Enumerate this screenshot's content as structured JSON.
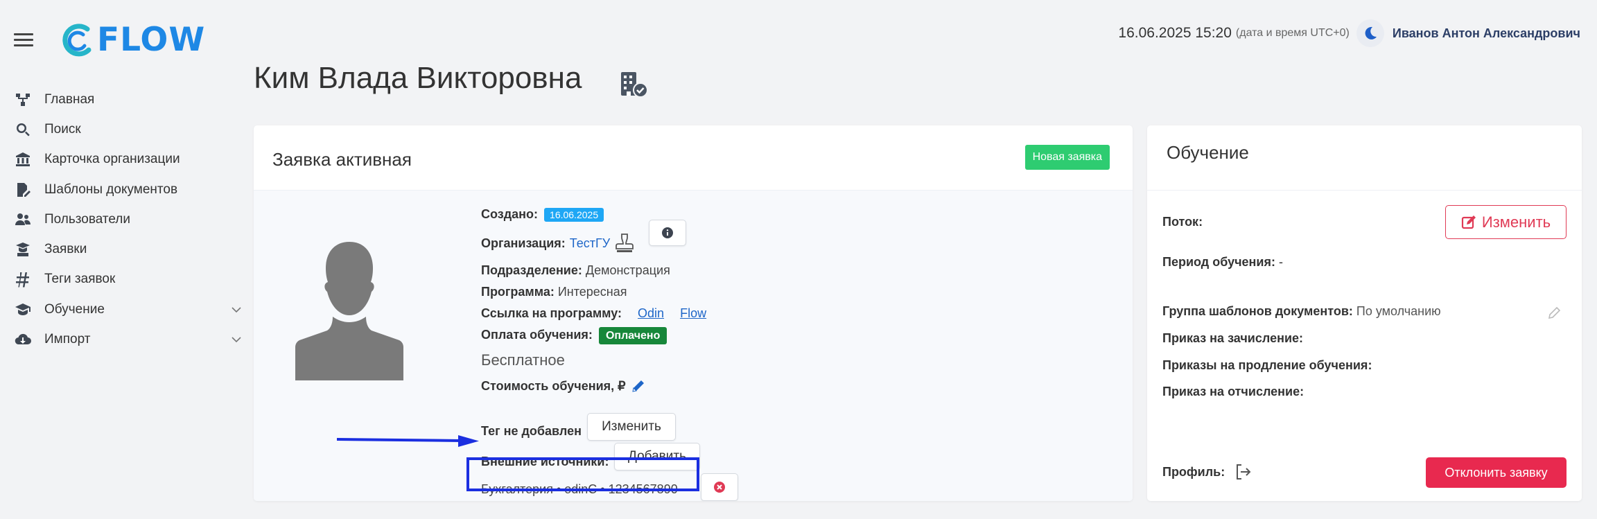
{
  "brand": {
    "name": "FLOW"
  },
  "header": {
    "datetime": "16.06.2025 15:20",
    "timezone_note": "(дата и время UTC+0)",
    "user_name": "Иванов Антон Александрович"
  },
  "sidebar": {
    "items": [
      {
        "label": "Главная",
        "icon": "sitemap-icon"
      },
      {
        "label": "Поиск",
        "icon": "search-icon"
      },
      {
        "label": "Карточка организации",
        "icon": "bank-icon"
      },
      {
        "label": "Шаблоны документов",
        "icon": "file-edit-icon"
      },
      {
        "label": "Пользователи",
        "icon": "users-icon"
      },
      {
        "label": "Заявки",
        "icon": "teacher-icon"
      },
      {
        "label": "Теги заявок",
        "icon": "hashtag-icon"
      },
      {
        "label": "Обучение",
        "icon": "graduation-cap-icon",
        "expandable": true
      },
      {
        "label": "Импорт",
        "icon": "cloud-download-icon",
        "expandable": true
      }
    ]
  },
  "page": {
    "title": "Ким Влада Викторовна"
  },
  "application": {
    "title": "Заявка активная",
    "status_badge": "Новая заявка",
    "created_label": "Создано:",
    "created_date": "16.06.2025",
    "org_label": "Организация:",
    "org_value": "ТестГУ",
    "division_label": "Подразделение:",
    "division_value": "Демонстрация",
    "program_label": "Программа:",
    "program_value": "Интересная",
    "program_link_label": "Ссылка на программу:",
    "program_links": [
      "Odin",
      "Flow"
    ],
    "payment_label": "Оплата обучения:",
    "payment_status": "Оплачено",
    "payment_type": "Бесплатное",
    "cost_label": "Стоимость обучения, ₽",
    "tag_label": "Тег не добавлен",
    "tag_button": "Изменить",
    "external_label": "Внешние источники:",
    "external_button": "Добавить",
    "external_source": "Бухгалтерия • odinC • 1234567890"
  },
  "training": {
    "title": "Обучение",
    "stream_label": "Поток:",
    "change_button": "Изменить",
    "period_label": "Период обучения:",
    "period_value": "-",
    "templates_label": "Группа шаблонов документов:",
    "templates_value": "По умолчанию",
    "enroll_label": "Приказ на зачисление:",
    "extend_label": "Приказы на продление обучения:",
    "expel_label": "Приказ на отчисление:",
    "profile_label": "Профиль:",
    "reject_button": "Отклонить заявку"
  },
  "colors": {
    "accent": "#1e88e5",
    "success": "#2ecc71",
    "paid": "#17873a",
    "danger": "#e8294f",
    "annotation": "#1b2fe0"
  }
}
